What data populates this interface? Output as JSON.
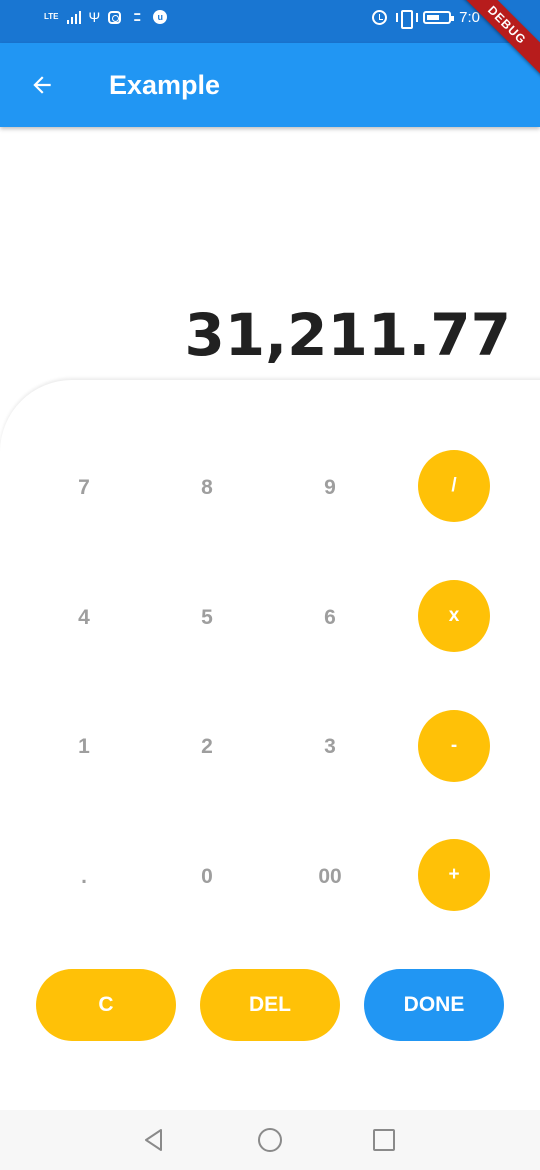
{
  "status_bar": {
    "network_label": "LTE",
    "time": "7:0",
    "icons": [
      "signal-icon",
      "usb-icon",
      "instagram-icon",
      "message-icon",
      "app-icon",
      "alarm-icon",
      "vibrate-icon",
      "battery-icon"
    ]
  },
  "debug_banner": "DEBUG",
  "app_bar": {
    "title": "Example",
    "back_icon": "arrow-back-icon"
  },
  "display": {
    "value": "31,211.77"
  },
  "keypad": {
    "rows": [
      [
        "7",
        "8",
        "9",
        "/"
      ],
      [
        "4",
        "5",
        "6",
        "x"
      ],
      [
        "1",
        "2",
        "3",
        "-"
      ],
      [
        ".",
        "0",
        "00",
        "+"
      ]
    ]
  },
  "actions": {
    "clear": "C",
    "delete": "DEL",
    "done": "DONE"
  },
  "nav_bar": {
    "icons": [
      "back-triangle-icon",
      "home-circle-icon",
      "recents-square-icon"
    ]
  },
  "colors": {
    "status_bar": "#1976D2",
    "app_bar": "#2196F3",
    "operator": "#FFC107",
    "done": "#2196F3",
    "digit_text": "#9E9E9E",
    "display_text": "#212121"
  }
}
